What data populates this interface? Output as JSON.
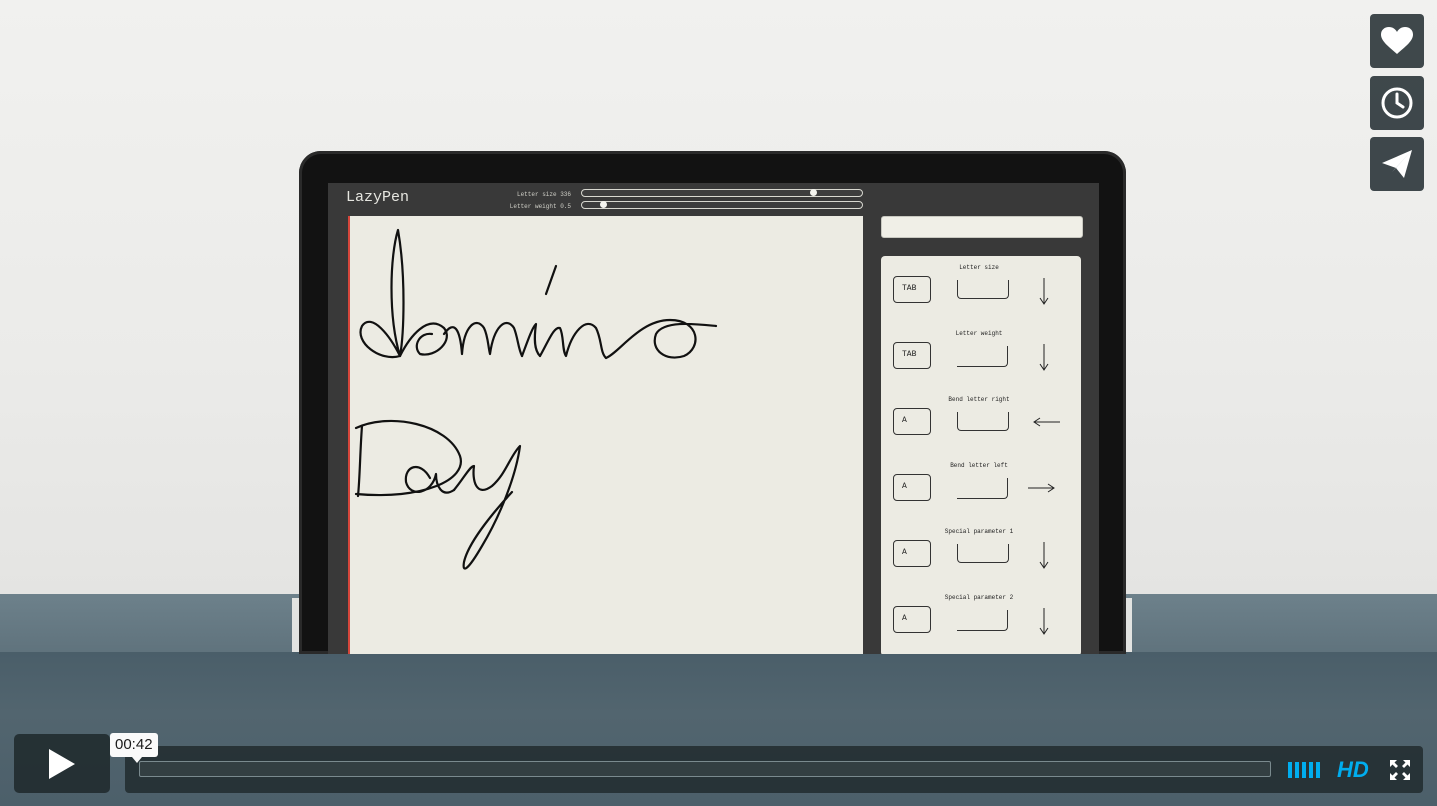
{
  "player": {
    "current_time": "00:42",
    "progress": 0.0,
    "hd_label": "HD",
    "accent_color": "#00adef",
    "icons": [
      "heart-icon",
      "clock-icon",
      "paper-plane-icon",
      "play-icon",
      "volume-bars-icon",
      "fullscreen-icon"
    ]
  },
  "app": {
    "title": "LazyPen",
    "sliders": [
      {
        "label": "Letter size 336",
        "value": 0.83
      },
      {
        "label": "Letter weight 0.5",
        "value": 0.08
      }
    ],
    "canvas_words": [
      "domino",
      "Day"
    ],
    "panel": [
      {
        "title": "Letter size",
        "key": "TAB",
        "arrow": "down"
      },
      {
        "title": "Letter weight",
        "key": "TAB",
        "arrow": "down"
      },
      {
        "title": "Bend letter right",
        "key": "A",
        "arrow": "left"
      },
      {
        "title": "Bend letter left",
        "key": "A",
        "arrow": "right"
      },
      {
        "title": "Special parameter 1",
        "key": "A",
        "arrow": "down"
      },
      {
        "title": "Special parameter 2",
        "key": "A",
        "arrow": "down"
      }
    ]
  }
}
